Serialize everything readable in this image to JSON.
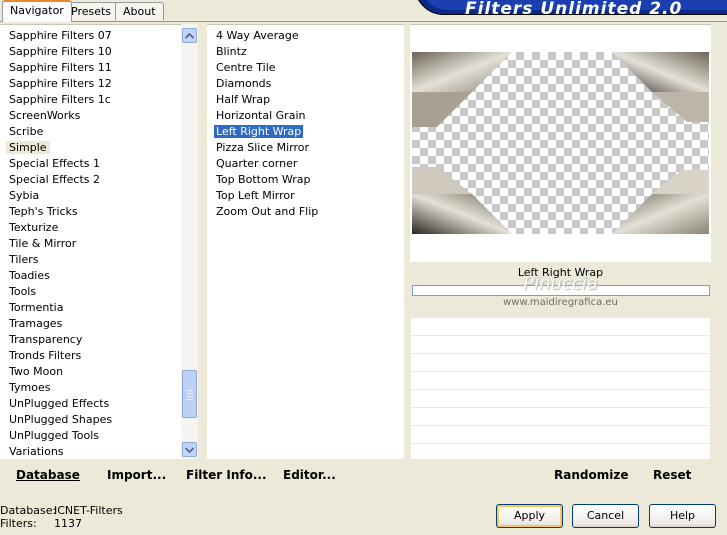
{
  "tabs": [
    "Navigator",
    "Presets",
    "About"
  ],
  "banner_title": "Filters Unlimited 2.0",
  "categories": [
    "Sapphire Filters 07",
    "Sapphire Filters 10",
    "Sapphire Filters 11",
    "Sapphire Filters 12",
    "Sapphire Filters 1c",
    "ScreenWorks",
    "Scribe",
    "Simple",
    "Special Effects 1",
    "Special Effects 2",
    "Sybia",
    "Teph's Tricks",
    "Texturize",
    "Tile & Mirror",
    "Tilers",
    "Toadies",
    "Tools",
    "Tormentia",
    "Tramages",
    "Transparency",
    "Tronds Filters",
    "Two Moon",
    "Tymoes",
    "UnPlugged Effects",
    "UnPlugged Shapes",
    "UnPlugged Tools",
    "Variations"
  ],
  "selected_category": "Simple",
  "filters": [
    "4 Way Average",
    "Blintz",
    "Centre Tile",
    "Diamonds",
    "Half Wrap",
    "Horizontal Grain",
    "Left Right Wrap",
    "Pizza Slice Mirror",
    "Quarter corner",
    "Top Bottom Wrap",
    "Top Left Mirror",
    "Zoom Out and Flip"
  ],
  "selected_filter": "Left Right Wrap",
  "preview": {
    "filter_name": "Left Right Wrap",
    "watermark_name": "Pinuccia",
    "watermark_url": "www.maidiregrafica.eu"
  },
  "toolbar": {
    "database": "Database",
    "import": "Import...",
    "filter_info": "Filter Info...",
    "editor": "Editor...",
    "randomize": "Randomize",
    "reset": "Reset"
  },
  "status": {
    "database_label": "Database:",
    "database_value": "ICNET-Filters",
    "filters_label": "Filters:",
    "filters_value": "1137"
  },
  "buttons": {
    "apply": "Apply",
    "cancel": "Cancel",
    "help": "Help"
  },
  "colors": {
    "selection": "#316ac5",
    "banner": "#1b3fb0",
    "default_button_border": "#f7c65e"
  }
}
